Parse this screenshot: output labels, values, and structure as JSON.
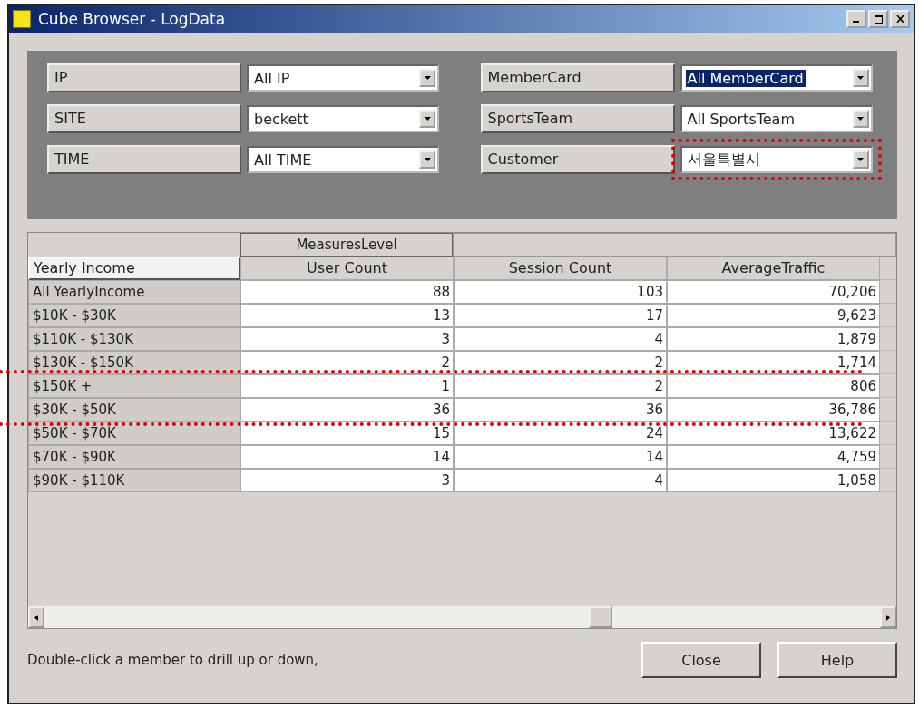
{
  "window": {
    "title": "Cube Browser - LogData"
  },
  "filters": [
    {
      "label": "IP",
      "value": "All IP",
      "focused": false,
      "highlighted": false
    },
    {
      "label": "SITE",
      "value": "beckett",
      "focused": false,
      "highlighted": false
    },
    {
      "label": "TIME",
      "value": "All TIME",
      "focused": false,
      "highlighted": false
    },
    {
      "label": "MemberCard",
      "value": "All MemberCard",
      "focused": true,
      "highlighted": false
    },
    {
      "label": "SportsTeam",
      "value": "All SportsTeam",
      "focused": false,
      "highlighted": false
    },
    {
      "label": "Customer",
      "value": "서울특별시",
      "focused": false,
      "highlighted": true
    }
  ],
  "grid": {
    "measures_label": "MeasuresLevel",
    "row_dimension": "Yearly Income",
    "columns": [
      "User Count",
      "Session Count",
      "AverageTraffic"
    ],
    "rows": [
      {
        "label": "All YearlyIncome",
        "values": [
          "88",
          "103",
          "70,206"
        ],
        "highlighted": false
      },
      {
        "label": "$10K - $30K",
        "values": [
          "13",
          "17",
          "9,623"
        ],
        "highlighted": false
      },
      {
        "label": "$110K - $130K",
        "values": [
          "3",
          "4",
          "1,879"
        ],
        "highlighted": false
      },
      {
        "label": "$130K - $150K",
        "values": [
          "2",
          "2",
          "1,714"
        ],
        "highlighted": false
      },
      {
        "label": "$150K +",
        "values": [
          "1",
          "2",
          "806"
        ],
        "highlighted": true
      },
      {
        "label": "$30K - $50K",
        "values": [
          "36",
          "36",
          "36,786"
        ],
        "highlighted": true
      },
      {
        "label": "$50K - $70K",
        "values": [
          "15",
          "24",
          "13,622"
        ],
        "highlighted": false
      },
      {
        "label": "$70K - $90K",
        "values": [
          "14",
          "14",
          "4,759"
        ],
        "highlighted": false
      },
      {
        "label": "$90K - $110K",
        "values": [
          "3",
          "4",
          "1,058"
        ],
        "highlighted": false
      }
    ]
  },
  "status": "Double-click a member to drill up or down,",
  "buttons": [
    "Close",
    "Help"
  ]
}
